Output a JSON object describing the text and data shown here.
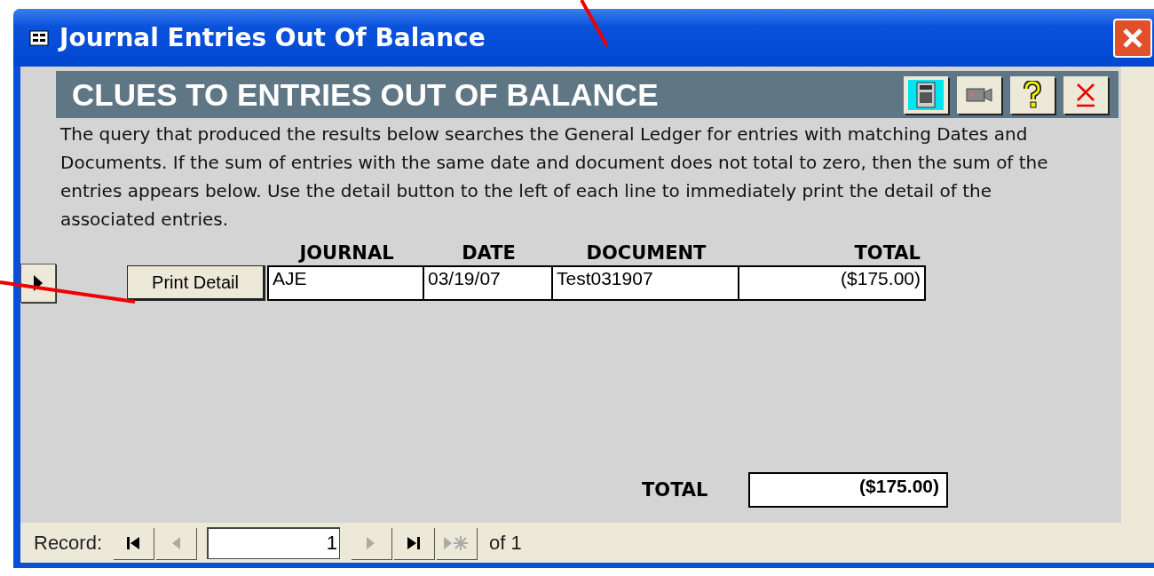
{
  "window": {
    "title": "Journal Entries Out Of Balance"
  },
  "header": {
    "title": "CLUES TO ENTRIES OUT OF BALANCE",
    "tools": [
      {
        "kind": "calculator"
      },
      {
        "kind": "camera"
      },
      {
        "kind": "help"
      },
      {
        "kind": "close"
      }
    ]
  },
  "description": "The query that produced the results below searches the General Ledger for entries with matching Dates and Documents.  If the sum of entries with the same date and document does not total to zero, then the sum of the entries appears below.  Use the detail button to the left of each line to immediately print the detail of the associated entries.",
  "table": {
    "columns": [
      "JOURNAL",
      "DATE",
      "DOCUMENT",
      "TOTAL"
    ],
    "rows": [
      {
        "selected": true,
        "button": "Print Detail",
        "cells": [
          "AJE",
          "03/19/07",
          "Test031907",
          "($175.00)"
        ]
      }
    ]
  },
  "footer": {
    "label": "TOTAL",
    "value": "($175.00)"
  },
  "navigation": {
    "label": "Record:",
    "buttons": [
      {
        "kind": "first",
        "disabled": false
      },
      {
        "kind": "prev",
        "disabled": true
      }
    ],
    "current": "1",
    "after": [
      {
        "kind": "next",
        "disabled": true
      },
      {
        "kind": "last",
        "disabled": false
      },
      {
        "kind": "new",
        "disabled": true
      }
    ],
    "of": "of 1"
  }
}
